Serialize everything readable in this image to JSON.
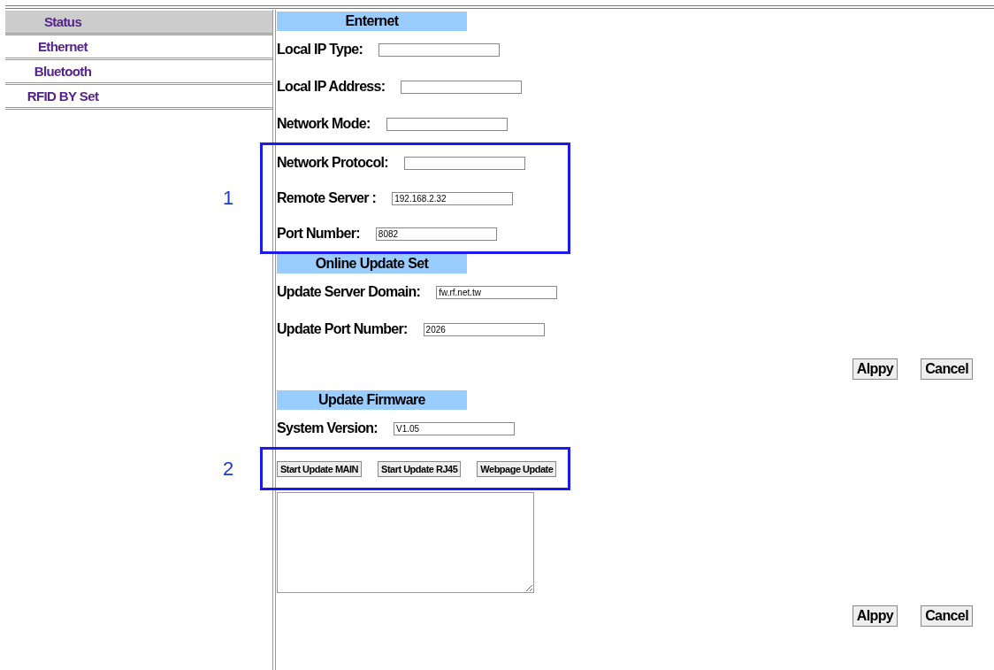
{
  "sidebar": {
    "items": [
      {
        "label": "Status",
        "selected": true
      },
      {
        "label": "Ethernet",
        "selected": false
      },
      {
        "label": "Bluetooth",
        "selected": false
      },
      {
        "label": "RFID BY Set",
        "selected": false
      }
    ]
  },
  "sections": [
    {
      "title": "Enternet",
      "rows": [
        {
          "kind": "field",
          "label": "Local IP Type:"
        },
        {
          "kind": "field",
          "label": "Local IP Address:"
        },
        {
          "kind": "field",
          "label": "Network Mode:"
        },
        {
          "kind": "callout",
          "number": "1",
          "rows": [
            {
              "kind": "field",
              "label": "Network Protocol:"
            },
            {
              "kind": "field",
              "label": "Remote Server :",
              "value": "192.168.2.32"
            },
            {
              "kind": "field",
              "label": "Port Number:",
              "value": "8082"
            }
          ]
        }
      ]
    },
    {
      "title": "Online Update Set",
      "rows": [
        {
          "kind": "field",
          "label": "Update Server Domain:",
          "value": "fw.rf.net.tw"
        },
        {
          "kind": "field",
          "label": "Update Port Number:",
          "value": "2026"
        },
        {
          "kind": "actions",
          "buttons": [
            "Alppy",
            "Cancel"
          ]
        }
      ]
    },
    {
      "title": "Update Firmware",
      "rows": [
        {
          "kind": "field",
          "label": "System Version:",
          "value": "V1.05"
        },
        {
          "kind": "callout",
          "number": "2",
          "rows": [
            {
              "kind": "buttons",
              "buttons": [
                "Start Update MAIN",
                "Start Update RJ45",
                "Webpage Update"
              ]
            }
          ]
        },
        {
          "kind": "log"
        },
        {
          "kind": "actions",
          "buttons": [
            "Alppy",
            "Cancel"
          ]
        }
      ]
    }
  ]
}
